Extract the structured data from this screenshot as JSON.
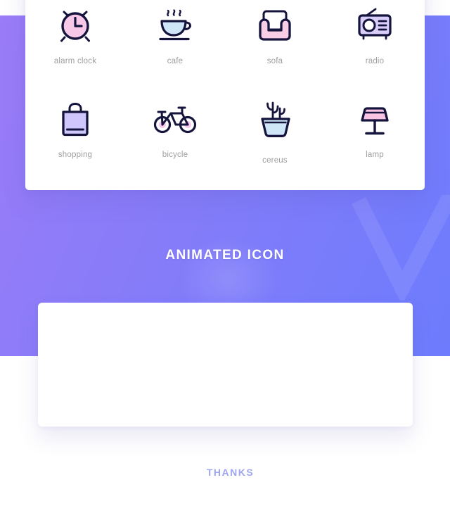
{
  "page": {
    "background_color": "#ffffff",
    "hero_gradient_from": "#9b7bf7",
    "hero_gradient_to": "#6d7cfc"
  },
  "icon_card": {
    "name": "icon-showcase-card",
    "label_color": "#9e9e9e",
    "icons": [
      {
        "id": "alarm-clock",
        "label": "alarm clock",
        "accent": "#f8c8e8",
        "stroke": "#14143c"
      },
      {
        "id": "cafe",
        "label": "cafe",
        "accent": "#cfe6f8",
        "stroke": "#14143c"
      },
      {
        "id": "sofa",
        "label": "sofa",
        "accent": "#f8cde6",
        "stroke": "#14143c"
      },
      {
        "id": "radio",
        "label": "radio",
        "accent": "#d9cdfa",
        "stroke": "#14143c"
      },
      {
        "id": "shopping",
        "label": "shopping",
        "accent": "#cfc6fb",
        "stroke": "#14143c"
      },
      {
        "id": "bicycle",
        "label": "bicycle",
        "accent": "#f7c6ea",
        "stroke": "#14143c"
      },
      {
        "id": "cereus",
        "label": "cereus",
        "accent": "#cfe6f8",
        "stroke": "#14143c"
      },
      {
        "id": "lamp",
        "label": "lamp",
        "accent": "#f9c4e4",
        "stroke": "#14143c"
      }
    ]
  },
  "hero": {
    "heading": "ANIMATED ICON",
    "heading_color": "#ffffff",
    "watermark_icon": "check-v-watermark"
  },
  "animation_card": {
    "name": "animated-icon-stage",
    "content": ""
  },
  "footer": {
    "thanks": "THANKS",
    "thanks_color": "#9fa6ef"
  }
}
